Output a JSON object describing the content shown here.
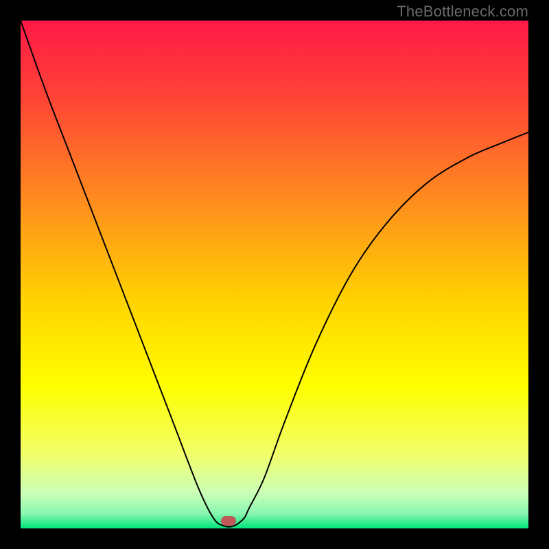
{
  "watermark": "TheBottleneck.com",
  "chart_data": {
    "type": "line",
    "title": "",
    "xlabel": "",
    "ylabel": "",
    "xlim": [
      0,
      100
    ],
    "ylim": [
      0,
      100
    ],
    "grid": false,
    "legend": false,
    "background_gradient": {
      "direction": "vertical",
      "stops": [
        {
          "pct": 0,
          "color": "#ff1947"
        },
        {
          "pct": 15,
          "color": "#ff4336"
        },
        {
          "pct": 35,
          "color": "#ff8b1f"
        },
        {
          "pct": 55,
          "color": "#ffd200"
        },
        {
          "pct": 72,
          "color": "#ffff00"
        },
        {
          "pct": 85,
          "color": "#f2ff66"
        },
        {
          "pct": 93,
          "color": "#ccffb8"
        },
        {
          "pct": 97,
          "color": "#8bf7b0"
        },
        {
          "pct": 100,
          "color": "#00e57a"
        }
      ]
    },
    "series": [
      {
        "name": "bottleneck-curve",
        "color": "#000000",
        "x": [
          0,
          5,
          10,
          15,
          20,
          25,
          30,
          35,
          38,
          40,
          42,
          44,
          45,
          48,
          52,
          58,
          65,
          72,
          80,
          88,
          95,
          100
        ],
        "y": [
          100,
          86,
          73,
          60,
          47,
          34,
          21,
          8,
          2,
          0.5,
          0.5,
          2,
          4,
          10,
          21,
          36,
          50,
          60,
          68,
          73,
          76,
          78
        ]
      }
    ],
    "marker": {
      "x": 41,
      "y": 1.5,
      "color": "#c05a5a"
    }
  }
}
